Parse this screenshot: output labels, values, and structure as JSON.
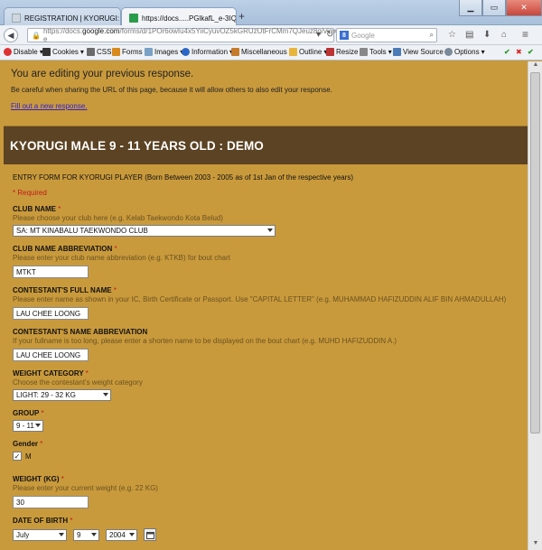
{
  "browser": {
    "tabs": [
      {
        "label": "REGISTRATION | KYORUGI: M ...",
        "active": false
      },
      {
        "label": "https://docs.....PGlkafL_e-3IQ",
        "active": true
      }
    ],
    "url_prefix": "https://docs.",
    "url_domain": "google.com",
    "url_rest": "/forms/d/1POr6owIu4x5YiiCyuvOZ5kGRUzUtFrCMm7QJeuz8g/viewform?e",
    "search_placeholder": "Google",
    "search_engine_badge": "8"
  },
  "devtoolbar": {
    "items": [
      "Disable",
      "Cookies",
      "CSS",
      "Forms",
      "Images",
      "Information",
      "Miscellaneous",
      "Outline",
      "Resize",
      "Tools",
      "View Source",
      "Options"
    ]
  },
  "notice": {
    "heading": "You are editing your previous response.",
    "warning": "Be careful when sharing the URL of this page, because it will allow others to also edit your response.",
    "link": "Fill out a new response."
  },
  "form": {
    "title": "KYORUGI MALE 9 - 11 YEARS OLD : DEMO",
    "description": "ENTRY FORM FOR KYORUGI PLAYER (Born Between 2003 - 2005 as of 1st Jan of the respective years)",
    "required_note": "* Required",
    "club_name": {
      "label": "CLUB NAME",
      "help": "Please choose your club here (e.g. Kelab Taekwondo Kota Belud)",
      "value": "SA: MT KINABALU TAEKWONDO CLUB"
    },
    "club_abbr": {
      "label": "CLUB NAME ABBREVIATION",
      "help": "Please enter your club name abbreviation (e.g. KTKB) for bout chart",
      "value": "MTKT"
    },
    "full_name": {
      "label": "CONTESTANT'S FULL NAME",
      "help": "Please enter name as shown in your IC, Birth Certificate or Passport. Use \"CAPITAL LETTER\" (e.g. MUHAMMAD HAFIZUDDIN ALIF BIN AHMADULLAH)",
      "value": "LAU CHEE LOONG"
    },
    "name_abbr": {
      "label": "CONTESTANT'S NAME ABBREVIATION",
      "help": "If your fullname is too long, please enter a shorten name to be displayed on the bout chart (e.g. MUHD HAFIZUDDIN A.)",
      "value": "LAU CHEE LOONG"
    },
    "weight_category": {
      "label": "WEIGHT CATEGORY",
      "help": "Choose the contestant's weight category",
      "value": "LIGHT: 29 - 32 KG"
    },
    "group": {
      "label": "GROUP",
      "value": "9 - 11"
    },
    "gender": {
      "label": "Gender",
      "option": "M",
      "checked": true
    },
    "weight": {
      "label": "WEIGHT (KG)",
      "help": "Please enter your current weight (e.g. 22 KG)",
      "value": "30"
    },
    "dob": {
      "label": "DATE OF BIRTH",
      "month": "July",
      "day": "9",
      "year": "2004"
    },
    "required_star": "*"
  }
}
